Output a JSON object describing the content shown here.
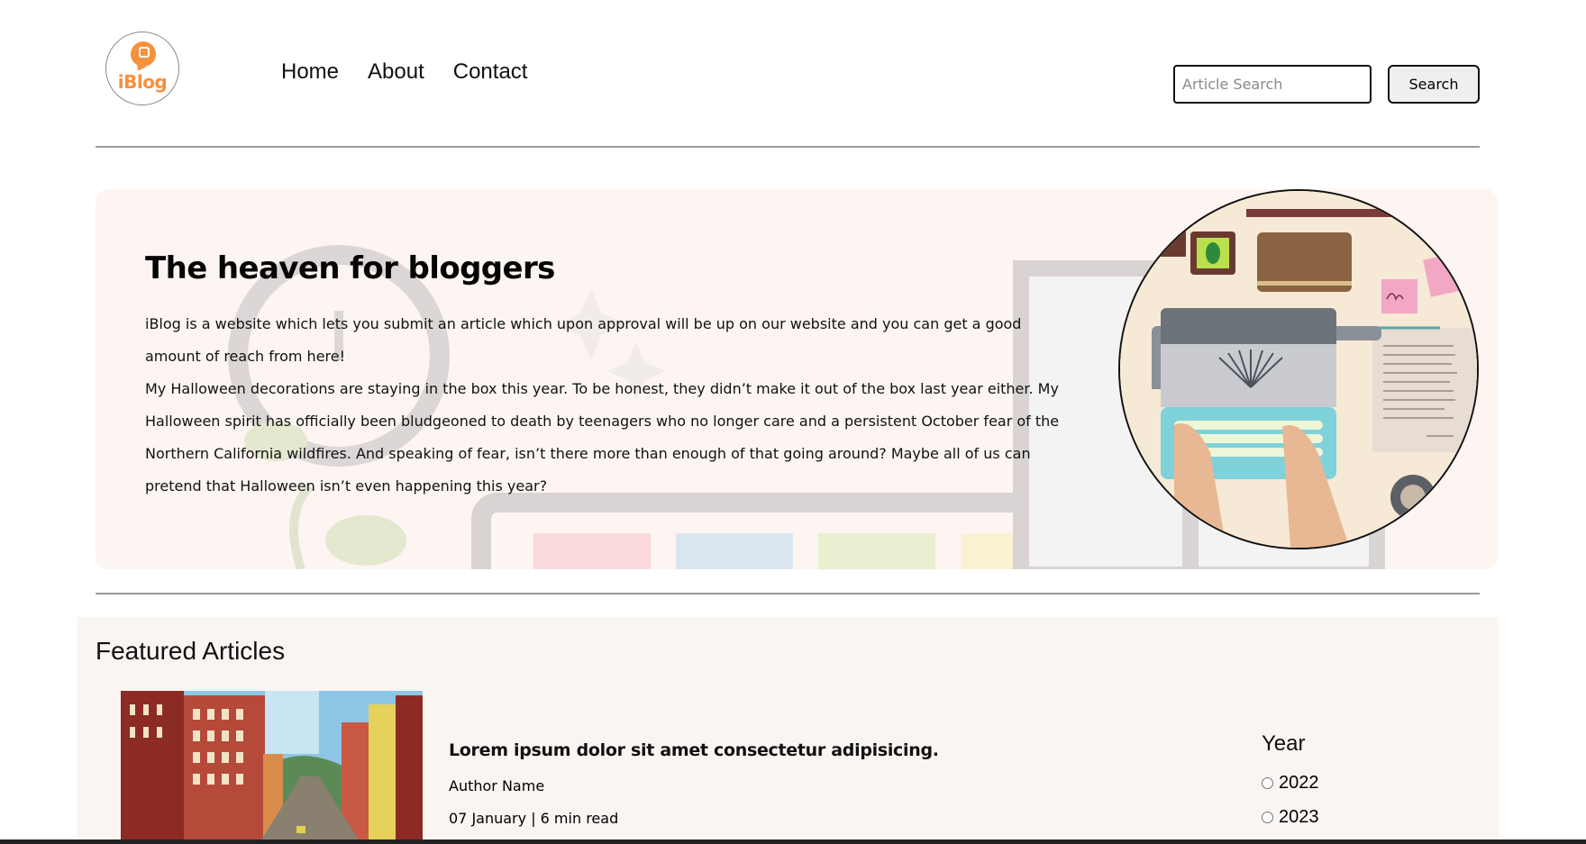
{
  "header": {
    "logo_text": "iBlog",
    "nav": [
      {
        "label": "Home"
      },
      {
        "label": "About"
      },
      {
        "label": "Contact"
      }
    ],
    "search": {
      "placeholder": "Article Search",
      "button_label": "Search"
    }
  },
  "hero": {
    "title": "The heaven for bloggers",
    "paragraph1": "iBlog is a website which lets you submit an article which upon approval will be up on our website and you can get a good amount of reach from here!",
    "paragraph2": "My Halloween decorations are staying in the box this year. To be honest, they didn’t make it out of the box last year either. My Halloween spirit has officially been bludgeoned to death by teenagers who no longer care and a persistent October fear of the Northern California wildfires. And speaking of fear, isn’t there more than enough of that going around? Maybe all of us can pretend that Halloween isn’t even happening this year?"
  },
  "featured": {
    "title": "Featured Articles",
    "article": {
      "title": "Lorem ipsum dolor sit amet consectetur adipisicing.",
      "author": "Author Name",
      "meta": "07 January | 6 min read"
    },
    "filter": {
      "title": "Year",
      "options": [
        "2022",
        "2023"
      ]
    }
  },
  "colors": {
    "brand_orange": "#f6913e",
    "hero_bg": "#fdf5f1",
    "featured_bg": "#faf5f3"
  }
}
